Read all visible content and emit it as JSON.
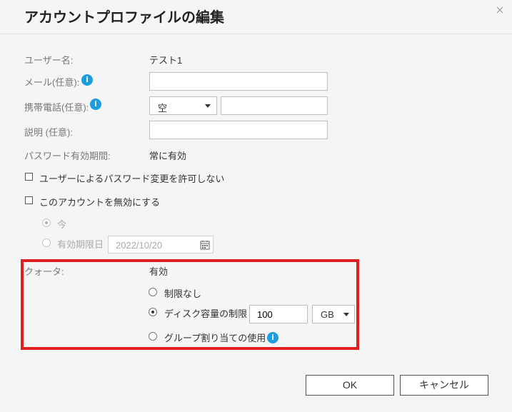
{
  "dialog": {
    "title": "アカウントプロファイルの編集"
  },
  "form": {
    "username_label": "ユーザー名:",
    "username_value": "テスト1",
    "email_label": "メール(任意):",
    "email_value": "",
    "phone_label": "携帯電話(任意):",
    "phone_country_value": "空",
    "phone_value": "",
    "description_label": "説明 (任意):",
    "description_value": "",
    "password_expiry_label": "パスワード有効期間:",
    "password_expiry_value": "常に有効",
    "disallow_password_change_label": "ユーザーによるパスワード変更を許可しない",
    "disable_account_label": "このアカウントを無効にする",
    "now_label": "今",
    "expiry_date_label": "有効期限日",
    "expiry_date_value": "2022/10/20"
  },
  "quota": {
    "label": "クォータ:",
    "status": "有効",
    "option_unlimited": "制限なし",
    "option_disk_limit": "ディスク容量の制限",
    "disk_limit_value": "100",
    "disk_limit_unit": "GB",
    "option_group": "グループ割り当ての使用"
  },
  "buttons": {
    "ok": "OK",
    "cancel": "キャンセル"
  },
  "icons": {
    "info": "info-icon",
    "close": "close-icon",
    "calendar": "calendar-icon"
  },
  "colors": {
    "accent": "#1a9ee0",
    "highlight": "#e02020"
  }
}
